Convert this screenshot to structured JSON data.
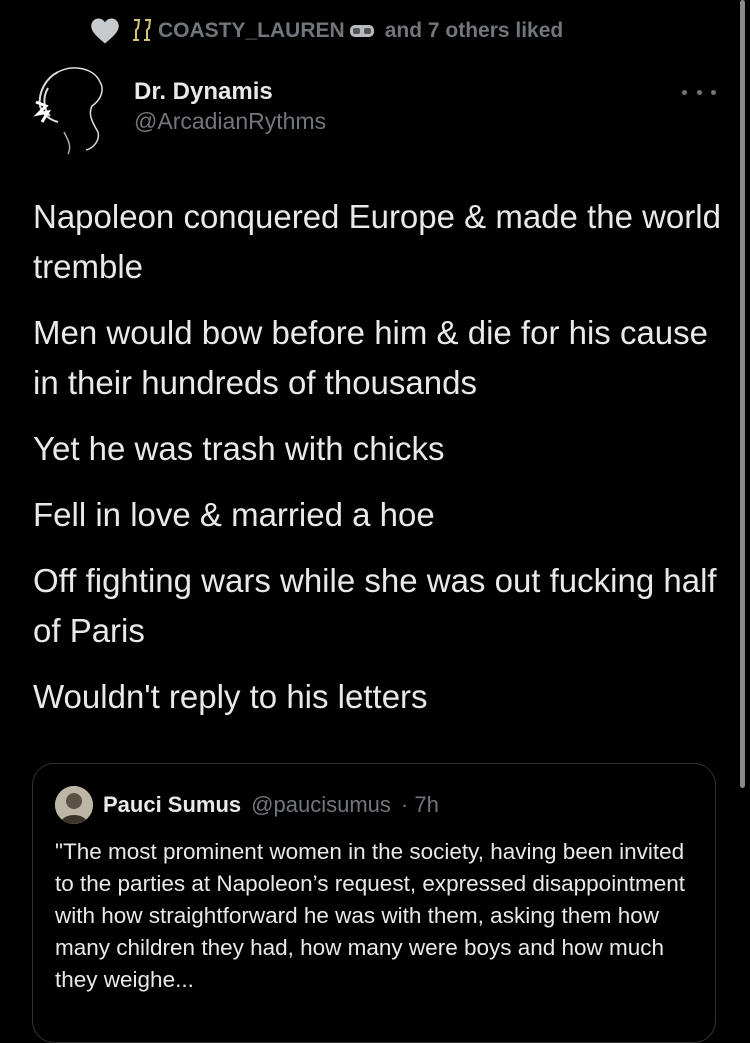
{
  "social_context": {
    "liker_name": "COASTY_LAUREN",
    "liked_suffix": "and 7 others liked",
    "icons": [
      "heart-icon",
      "champagne-icon",
      "goggles-icon"
    ]
  },
  "author": {
    "display_name": "Dr. Dynamis",
    "handle": "@ArcadianRythms"
  },
  "tweet": {
    "paragraphs": [
      "Napoleon conquered Europe & made the world tremble",
      "Men would bow before him & die for his cause in their hundreds of thousands",
      "Yet he was trash with chicks",
      "Fell in love & married a hoe",
      "Off fighting wars while she was out fucking half of Paris",
      "Wouldn't reply to his letters"
    ]
  },
  "quote": {
    "display_name": "Pauci Sumus",
    "handle": "@paucisumus",
    "time": "· 7h",
    "text": "\"The most prominent women in the society, having been invited to the parties at Napoleon’s request, expressed disappointment with how straightforward he was with them, asking them how many children they had, how many were boys and how much they weighe..."
  },
  "colors": {
    "background": "#000000",
    "primary_text": "#e7e9ea",
    "secondary_text": "#71767b",
    "border": "#2f3336"
  }
}
